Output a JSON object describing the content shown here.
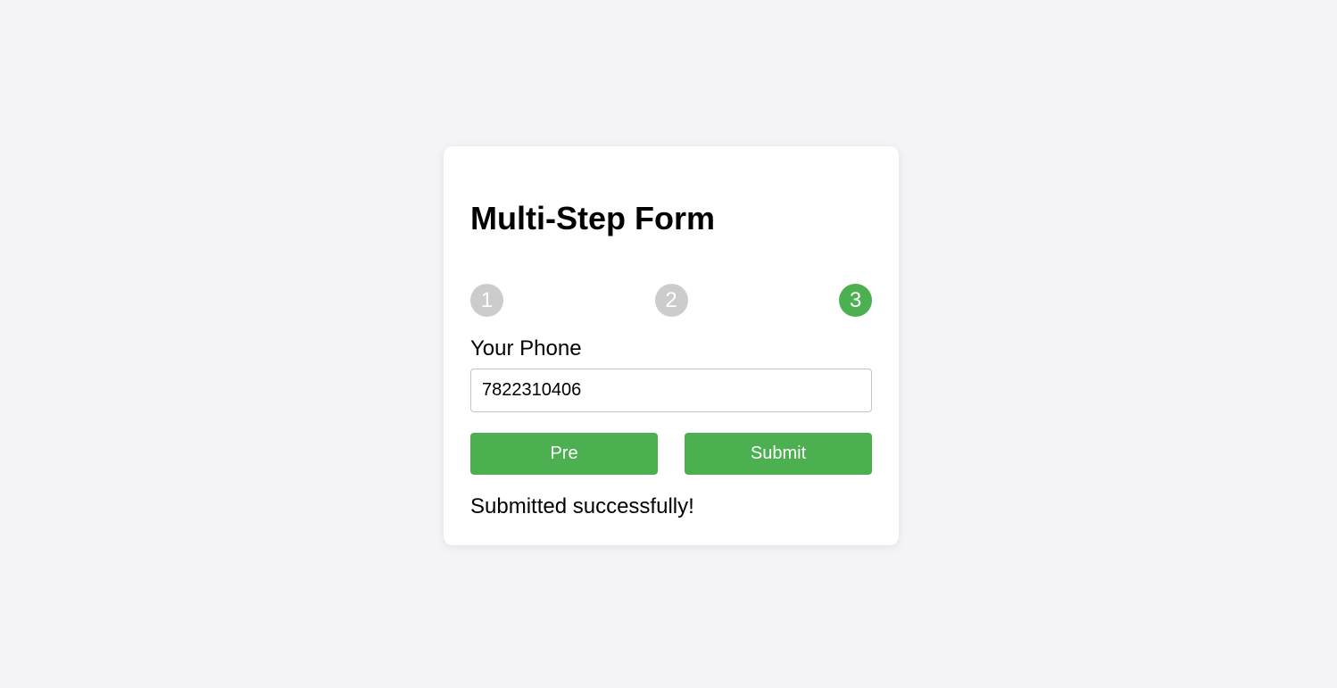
{
  "form": {
    "title": "Multi-Step Form",
    "steps": [
      {
        "label": "1",
        "active": false
      },
      {
        "label": "2",
        "active": false
      },
      {
        "label": "3",
        "active": true
      }
    ],
    "field_label": "Your Phone",
    "field_value": "7822310406",
    "prev_label": "Pre",
    "submit_label": "Submit",
    "status_message": "Submitted successfully!"
  },
  "colors": {
    "accent": "#4caf50",
    "inactive_step": "#cccccc",
    "background": "#f4f4f8"
  }
}
